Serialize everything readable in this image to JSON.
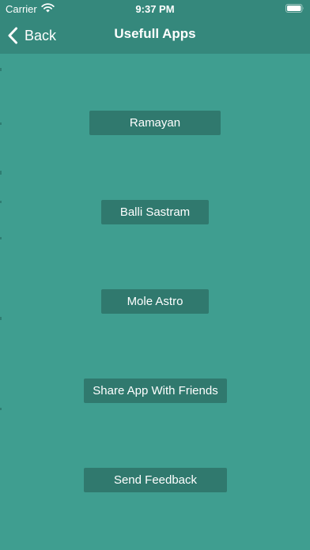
{
  "status_bar": {
    "carrier": "Carrier",
    "time": "9:37 PM"
  },
  "nav_bar": {
    "back_label": "Back",
    "title": "Usefull Apps"
  },
  "buttons": {
    "ramayan": "Ramayan",
    "balli_sastram": "Balli Sastram",
    "mole_astro": "Mole Astro",
    "share_app": "Share App With Friends",
    "send_feedback": "Send Feedback"
  },
  "colors": {
    "background": "#3f9e90",
    "nav_bar": "#35887c",
    "button": "#30796e",
    "text": "#ffffff"
  },
  "icons": {
    "wifi": "wifi-icon",
    "battery": "battery-icon",
    "back": "chevron-left-icon"
  }
}
